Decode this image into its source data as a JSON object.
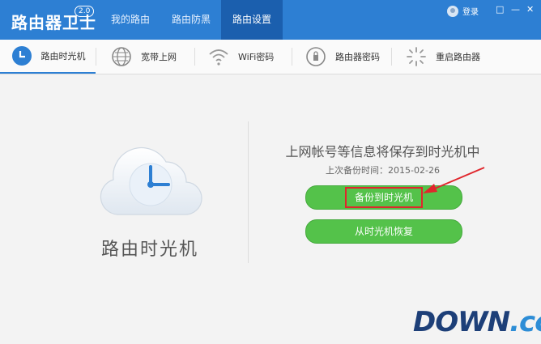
{
  "app": {
    "title": "路由器卫士",
    "version": "2.0"
  },
  "nav": {
    "tabs": [
      "我的路由",
      "路由防黑",
      "路由设置"
    ],
    "active": 2
  },
  "account": {
    "login_label": "登录"
  },
  "window": {
    "controls": [
      "□",
      "—",
      "✕"
    ]
  },
  "subnav": {
    "items": [
      {
        "label": "路由时光机",
        "icon": "clock-cloud-icon"
      },
      {
        "label": "宽带上网",
        "icon": "globe-icon"
      },
      {
        "label": "WiFi密码",
        "icon": "wifi-icon"
      },
      {
        "label": "路由器密码",
        "icon": "lock-icon"
      },
      {
        "label": "重启路由器",
        "icon": "restart-icon"
      }
    ],
    "active": 0
  },
  "main": {
    "feature_title": "路由时光机",
    "info": "上网帐号等信息将保存到时光机中",
    "last_backup": "上次备份时间：2015-02-26",
    "backup_button": "备份到时光机",
    "restore_button": "从时光机恢复"
  },
  "watermark": {
    "text": "DOWN",
    "suffix": ".cc"
  },
  "colors": {
    "accent": "#2d7fd3",
    "button": "#54c24a",
    "highlight": "#e0262c"
  }
}
